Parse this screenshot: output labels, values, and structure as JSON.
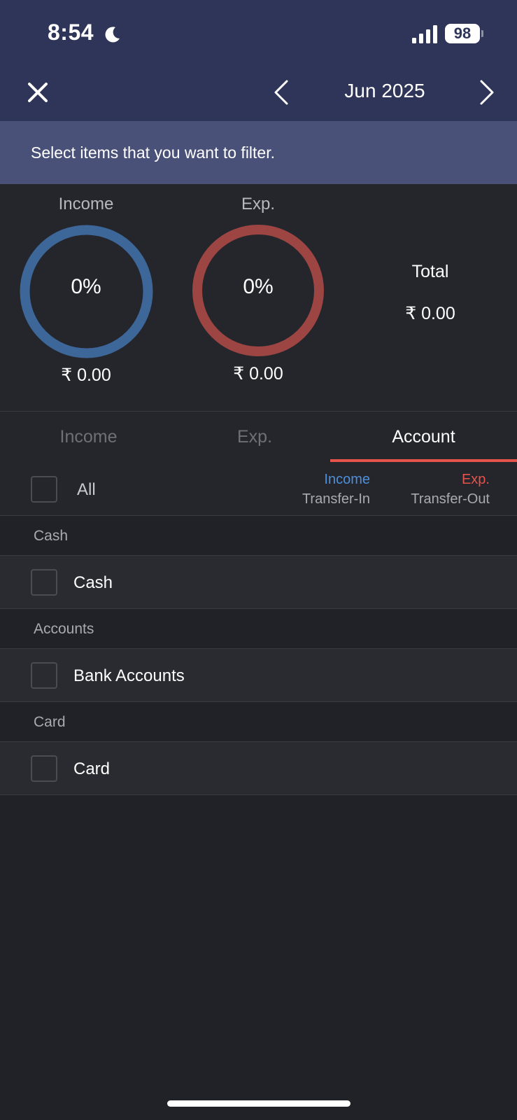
{
  "status_bar": {
    "time": "8:54",
    "battery": "98"
  },
  "nav": {
    "month": "Jun 2025"
  },
  "banner": {
    "text": "Select items that you want to filter."
  },
  "summary": {
    "income": {
      "label": "Income",
      "percent": "0%",
      "amount": "₹ 0.00",
      "color": "#3d6699",
      "fraction": 0
    },
    "expense": {
      "label": "Exp.",
      "percent": "0%",
      "amount": "₹ 0.00",
      "color": "#9c4543",
      "fraction": 0
    },
    "total": {
      "label": "Total",
      "amount": "₹ 0.00"
    }
  },
  "tabs": [
    {
      "label": "Income",
      "active": false
    },
    {
      "label": "Exp.",
      "active": false
    },
    {
      "label": "Account",
      "active": true
    }
  ],
  "list_header": {
    "all_label": "All",
    "col1_top": "Income",
    "col1_bottom": "Transfer-In",
    "col2_top": "Exp.",
    "col2_bottom": "Transfer-Out"
  },
  "groups": [
    {
      "title": "Cash",
      "items": [
        {
          "label": "Cash"
        }
      ]
    },
    {
      "title": "Accounts",
      "items": [
        {
          "label": "Bank Accounts"
        }
      ]
    },
    {
      "title": "Card",
      "items": [
        {
          "label": "Card"
        }
      ]
    }
  ],
  "colors": {
    "accent": "#e5534b",
    "header_bg": "#2f3559",
    "banner_bg": "#4a5179",
    "income_blue": "#4f8fd9"
  }
}
